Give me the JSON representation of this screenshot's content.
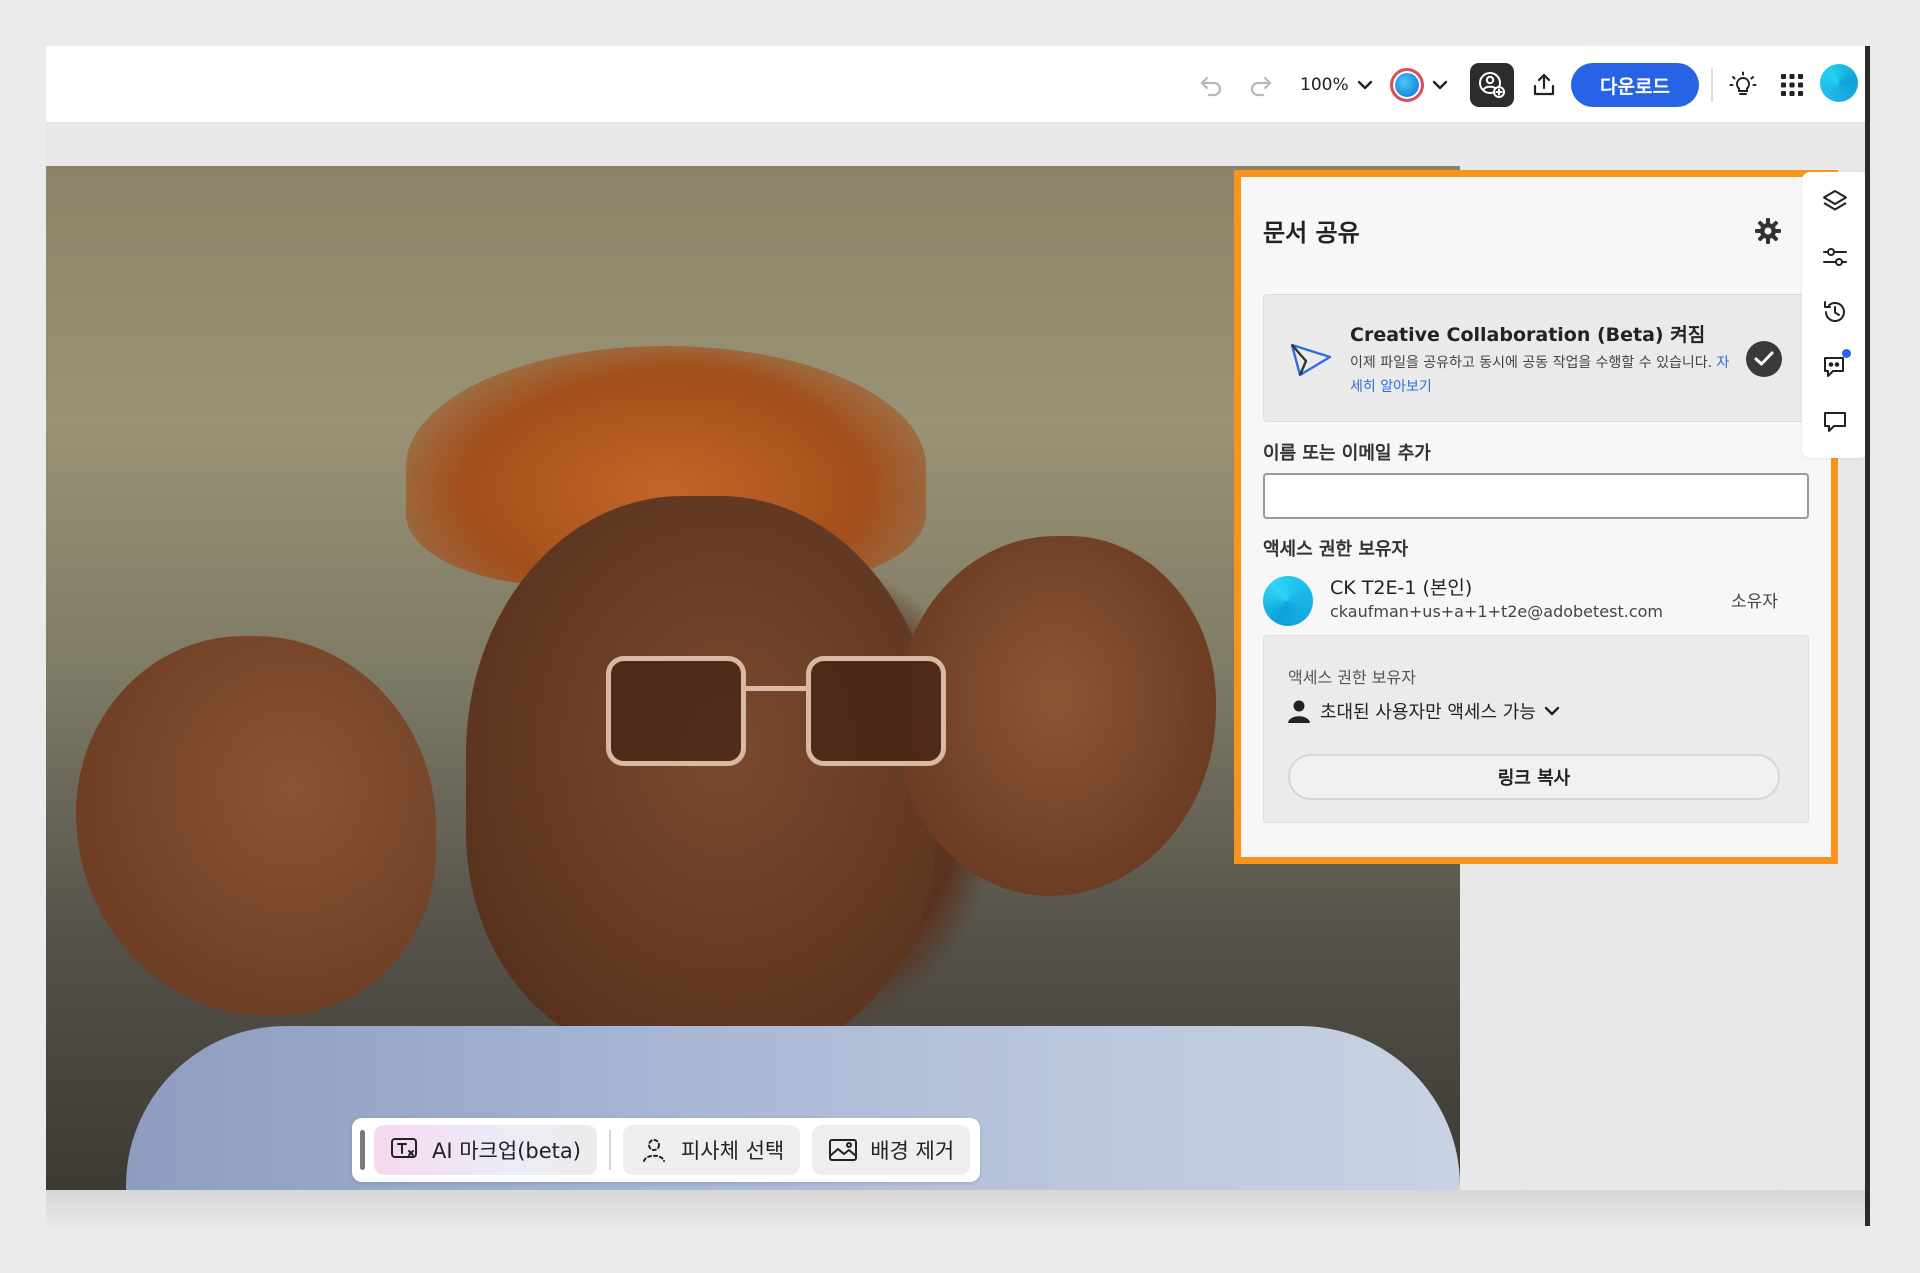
{
  "topbar": {
    "zoom_label": "100%",
    "download_label": "다운로드",
    "icons": {
      "undo": "undo-icon",
      "redo": "redo-icon",
      "zoom_dropdown": "chevron-down-icon",
      "color": "color-swatch-icon",
      "collab": "collaborate-icon",
      "export": "share-upload-icon",
      "bulb": "lightbulb-icon",
      "apps": "apps-grid-icon"
    }
  },
  "share_panel": {
    "title": "문서 공유",
    "collab_card": {
      "title": "Creative Collaboration (Beta) 켜짐",
      "description": "이제 파일을 공유하고 동시에 공동 작업을 수행할 수 있습니다.",
      "link": "자세히 알아보기"
    },
    "add_label": "이름 또는 이메일 추가",
    "add_placeholder": "",
    "access_holders_label": "액세스 권한 보유자",
    "member": {
      "name": "CK T2E-1 (본인)",
      "email": "ckaufman+us+a+1+t2e@adobetest.com",
      "role": "소유자"
    },
    "access_box": {
      "label": "액세스 권한 보유자",
      "selected_option": "초대된 사용자만 액세스 가능",
      "copy_link_label": "링크 복사"
    },
    "highlight_color": "#f7941d"
  },
  "quick_actions": {
    "items": [
      {
        "label": "AI 마크업(beta)",
        "icon": "ai-markup-icon"
      },
      {
        "label": "피사체 선택",
        "icon": "select-subject-icon"
      },
      {
        "label": "배경 제거",
        "icon": "remove-background-icon"
      }
    ]
  },
  "right_rail": {
    "icons": [
      "layers-icon",
      "adjustments-icon",
      "history-icon",
      "collab-comments-icon",
      "comment-icon"
    ]
  },
  "colors": {
    "accent": "#2763e6",
    "panel_border": "#f7941d"
  }
}
